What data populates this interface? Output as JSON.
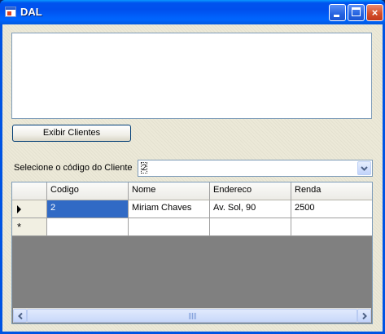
{
  "window": {
    "title": "DAL",
    "icon": "app-window-icon",
    "buttons": {
      "minimize": "minimize-icon",
      "maximize": "maximize-icon",
      "close": "×"
    }
  },
  "output_text": "",
  "exibir_button_label": "Exibir Clientes",
  "select_label": "Selecione o código do Cliente",
  "combo": {
    "value": "2",
    "icon": "chevron-down-icon"
  },
  "grid": {
    "columns": [
      "Codigo",
      "Nome",
      "Endereco",
      "Renda"
    ],
    "rows": [
      {
        "codigo": "2",
        "nome": "Miriam Chaves",
        "endereco": "Av. Sol, 90",
        "renda": "2500"
      }
    ],
    "new_row_marker": "*",
    "current_row_icon": "row-pointer-icon"
  },
  "colors": {
    "title_bar": "#0054e3",
    "selection": "#316ac5",
    "grid_background": "#808080",
    "form_background": "#ece9d8"
  }
}
